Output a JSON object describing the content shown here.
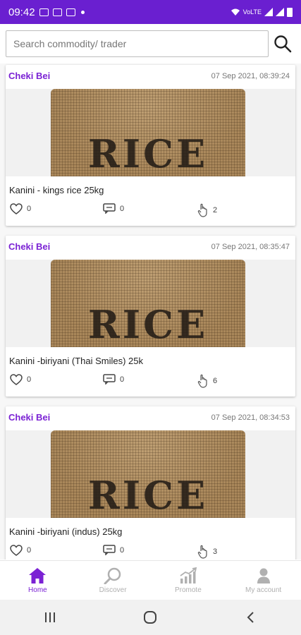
{
  "status": {
    "time": "09:42",
    "network": "VoLTE"
  },
  "search": {
    "placeholder": "Search commodity/ trader"
  },
  "posts": [
    {
      "trader": "Cheki Bei",
      "timestamp": "07 Sep 2021, 08:39:24",
      "image_label": "RICE",
      "title": "Kanini - kings rice 25kg",
      "likes": "0",
      "comments": "0",
      "views": "2"
    },
    {
      "trader": "Cheki Bei",
      "timestamp": "07 Sep 2021, 08:35:47",
      "image_label": "RICE",
      "title": "Kanini -biriyani (Thai Smiles) 25k",
      "likes": "0",
      "comments": "0",
      "views": "6"
    },
    {
      "trader": "Cheki Bei",
      "timestamp": "07 Sep 2021, 08:34:53",
      "image_label": "RICE",
      "title": "Kanini -biriyani (indus) 25kg",
      "likes": "0",
      "comments": "0",
      "views": "3"
    }
  ],
  "nav": {
    "home": "Home",
    "discover": "Discover",
    "promote": "Promote",
    "account": "My account"
  },
  "colors": {
    "brand": "#6a1fd0",
    "accent": "#7b22d4",
    "inactive": "#b0b0b0"
  },
  "icons": [
    "search-icon",
    "heart-icon",
    "comment-icon",
    "tap-icon",
    "home-icon",
    "discover-icon",
    "promote-icon",
    "account-icon",
    "recents-icon",
    "home-circle-icon",
    "back-icon"
  ]
}
